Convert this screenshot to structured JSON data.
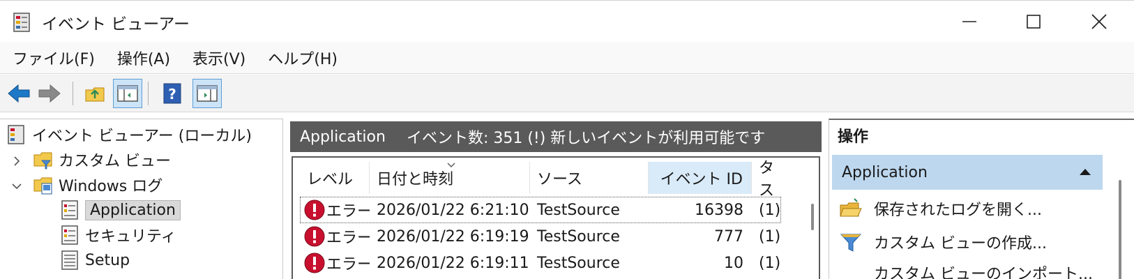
{
  "window": {
    "title": "イベント ビューアー",
    "controls": {
      "minimize": "minimize-icon",
      "maximize": "maximize-icon",
      "close": "close-icon"
    }
  },
  "menu": [
    "ファイル(F)",
    "操作(A)",
    "表示(V)",
    "ヘルプ(H)"
  ],
  "toolbar": {
    "buttons": [
      "back-arrow-icon",
      "forward-arrow-icon",
      "up-folder-icon",
      "show-hide-tree-icon",
      "help-icon",
      "show-hide-action-icon"
    ]
  },
  "tree": {
    "root": "イベント ビューアー (ローカル)",
    "custom_views": "カスタム ビュー",
    "windows_logs": "Windows ログ",
    "application": "Application",
    "security": "セキュリティ",
    "setup": "Setup"
  },
  "center": {
    "header_app": "Application",
    "header_info": "イベント数: 351 (!) 新しいイベントが利用可能です",
    "columns": [
      "レベル",
      "日付と時刻",
      "ソース",
      "イベント ID",
      "タス"
    ],
    "rows": [
      {
        "level": "エラー",
        "datetime": "2026/01/22 6:21:10",
        "source": "TestSource",
        "event_id": "16398",
        "task": "(1)"
      },
      {
        "level": "エラー",
        "datetime": "2026/01/22 6:19:19",
        "source": "TestSource",
        "event_id": "777",
        "task": "(1)"
      },
      {
        "level": "エラー",
        "datetime": "2026/01/22 6:19:11",
        "source": "TestSource",
        "event_id": "10",
        "task": "(1)"
      }
    ]
  },
  "actions": {
    "title": "操作",
    "section": "Application",
    "items": [
      "保存されたログを開く...",
      "カスタム ビューの作成...",
      "カスタム ビューのインポート..."
    ]
  },
  "colors": {
    "header_dark": "#5a5a5a",
    "section_blue": "#bdd7ee",
    "sorted_col": "#d9ebf9",
    "error_red": "#c8102e",
    "arrow_blue": "#1e78c8"
  }
}
